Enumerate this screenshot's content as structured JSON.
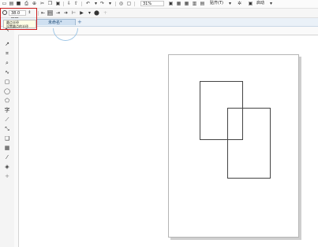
{
  "toolbar": {
    "zoom_value": "31%",
    "snap_label": "贴齐(T)",
    "launch_label": "启动"
  },
  "property_bar": {
    "outline_width_value": "38.0 mm"
  },
  "tooltip": {
    "line1": "圆点半径",
    "line2": "设置圆点的半径"
  },
  "document": {
    "tab_label": "未命名*"
  },
  "colors": {
    "highlight": "#cc1d1d",
    "tab": "#cfe0f1",
    "accent": "#1d4a75"
  }
}
